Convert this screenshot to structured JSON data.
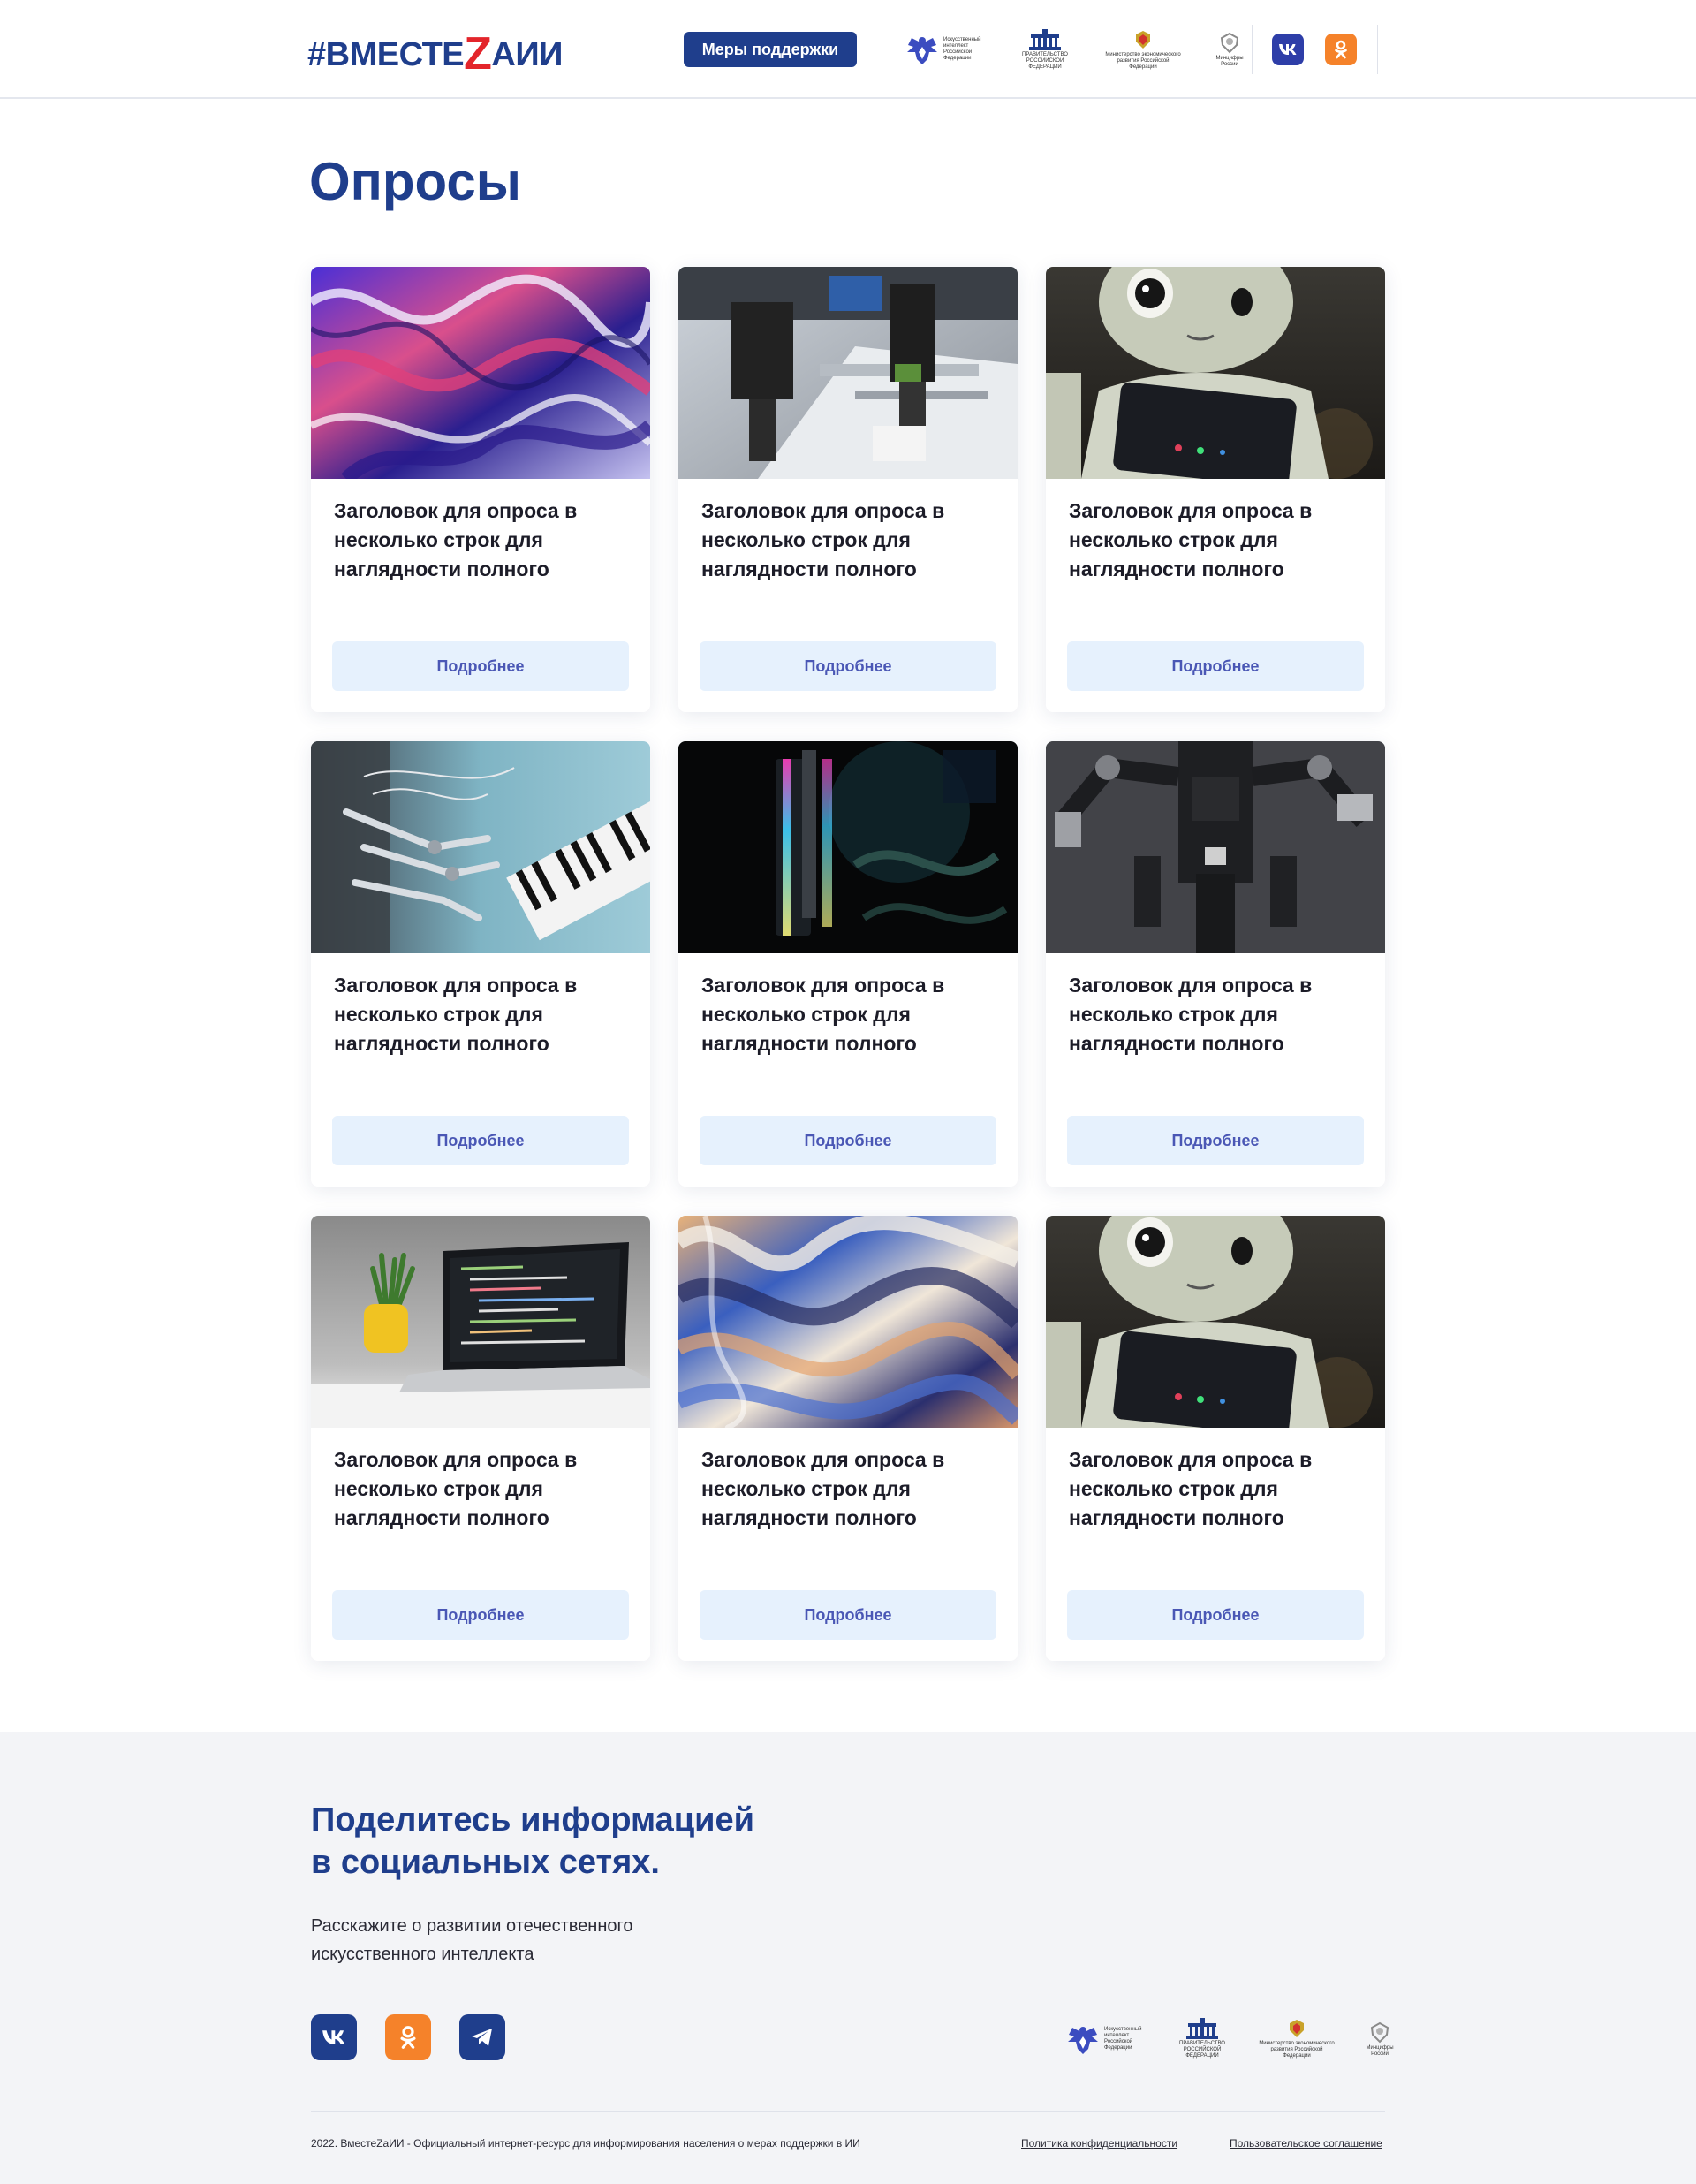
{
  "header": {
    "logo_prefix": "#ВМЕСТЕ",
    "logo_z": "Z",
    "logo_suffix": "АИИ",
    "support_button": "Меры поддержки",
    "orgs": [
      {
        "icon": "eagle-emblem-icon",
        "text": "Искусственный интеллект Российской Федерации"
      },
      {
        "icon": "government-building-icon",
        "text": "ПРАВИТЕЛЬСТВО РОССИЙСКОЙ ФЕДЕРАЦИИ"
      },
      {
        "icon": "ministry-emblem-icon",
        "text": "Министерство экономического развития Российской Федерации"
      },
      {
        "icon": "ministry-digital-emblem-icon",
        "text": "Минцифры России"
      }
    ],
    "social": [
      {
        "icon": "vk-icon",
        "color": "#2e3ea8"
      },
      {
        "icon": "odnoklassniki-icon",
        "color": "#f5822a"
      }
    ]
  },
  "page": {
    "title": "Опросы"
  },
  "cards": [
    {
      "image": "fluid-abstract-purple",
      "title": "Заголовок для опроса в несколько строк для наглядности полного",
      "button": "Подробнее"
    },
    {
      "image": "industrial-robot-arm",
      "title": "Заголовок для опроса в несколько строк для наглядности полного",
      "button": "Подробнее"
    },
    {
      "image": "humanoid-robot",
      "title": "Заголовок для опроса в несколько строк для наглядности полного",
      "button": "Подробнее"
    },
    {
      "image": "robot-hand-piano",
      "title": "Заголовок для опроса в несколько строк для наглядности полного",
      "button": "Подробнее"
    },
    {
      "image": "rgb-ram-module",
      "title": "Заголовок для опроса в несколько строк для наглядности полного",
      "button": "Подробнее"
    },
    {
      "image": "mechanical-robot",
      "title": "Заголовок для опроса в несколько строк для наглядности полного",
      "button": "Подробнее"
    },
    {
      "image": "laptop-code",
      "title": "Заголовок для опроса в несколько строк для наглядности полного",
      "button": "Подробнее"
    },
    {
      "image": "holographic-waves",
      "title": "Заголовок для опроса в несколько строк для наглядности полного",
      "button": "Подробнее"
    },
    {
      "image": "humanoid-robot",
      "title": "Заголовок для опроса в несколько строк для наглядности полного",
      "button": "Подробнее"
    }
  ],
  "footer": {
    "share_title_line1": "Поделитесь информацией",
    "share_title_line2": "в социальных сетях.",
    "share_sub_line1": "Расскажите о развитии отечественного",
    "share_sub_line2": "искусственного интеллекта",
    "social": [
      {
        "icon": "vk-icon",
        "color": "#1f3e8c"
      },
      {
        "icon": "odnoklassniki-icon",
        "color": "#f5822a"
      },
      {
        "icon": "telegram-icon",
        "color": "#1f3e8c"
      }
    ],
    "copyright": "2022. ВместеZаИИ - Официальный интернет-ресурс для информирования населения о мерах поддержки в ИИ",
    "privacy_link": "Политика конфиденциальности",
    "terms_link": "Пользовательское соглашение"
  }
}
